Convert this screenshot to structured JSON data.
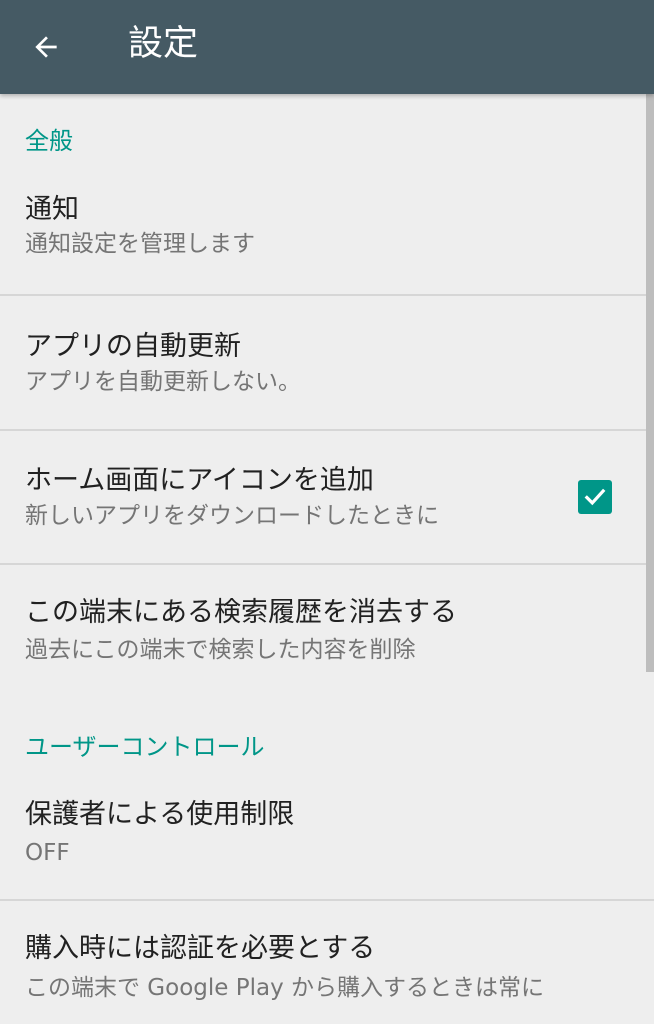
{
  "appbar": {
    "title": "設定",
    "back_icon": "arrow-back-icon"
  },
  "sections": {
    "general": {
      "header": "全般",
      "notifications": {
        "title": "通知",
        "subtitle": "通知設定を管理します"
      },
      "auto_update": {
        "title": "アプリの自動更新",
        "subtitle": "アプリを自動更新しない。"
      },
      "add_icon": {
        "title": "ホーム画面にアイコンを追加",
        "subtitle": "新しいアプリをダウンロードしたときに",
        "checked": true
      },
      "clear_history": {
        "title": "この端末にある検索履歴を消去する",
        "subtitle": "過去にこの端末で検索した内容を削除"
      }
    },
    "user_controls": {
      "header": "ユーザーコントロール",
      "parental": {
        "title": "保護者による使用制限",
        "subtitle": "OFF"
      },
      "purchase_auth": {
        "title": "購入時には認証を必要とする",
        "subtitle": "この端末で Google Play から購入するときは常に"
      }
    }
  },
  "colors": {
    "appbar": "#455a64",
    "accent": "#009688",
    "background": "#eeeeee",
    "title_text": "#212121",
    "subtitle_text": "#757575"
  }
}
